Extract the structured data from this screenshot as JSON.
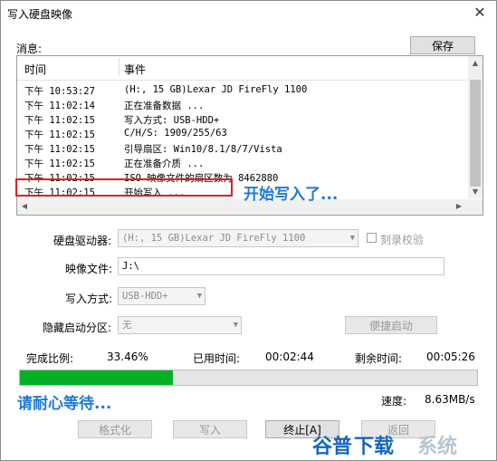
{
  "window": {
    "title": "写入硬盘映像",
    "close_glyph": "✕"
  },
  "messages": {
    "label": "消息:",
    "save_button": "保存",
    "columns": {
      "time": "时间",
      "event": "事件"
    },
    "rows": [
      {
        "time": "下午 10:53:27",
        "event": "(H:, 15 GB)Lexar   JD FireFly      1100"
      },
      {
        "time": "下午 11:02:14",
        "event": "正在准备数据 ..."
      },
      {
        "time": "下午 11:02:15",
        "event": "写入方式: USB-HDD+"
      },
      {
        "time": "下午 11:02:15",
        "event": "C/H/S: 1909/255/63"
      },
      {
        "time": "下午 11:02:15",
        "event": "引导扇区: Win10/8.1/8/7/Vista"
      },
      {
        "time": "下午 11:02:15",
        "event": "正在准备介质 ..."
      },
      {
        "time": "下午 11:02:15",
        "event": "ISO 映像文件的扇区数为 8462880"
      },
      {
        "time": "下午 11:02:15",
        "event": "开始写入 ..."
      }
    ]
  },
  "annotations": {
    "writing_started": "开始写入了...",
    "please_wait": "请耐心等待..."
  },
  "form": {
    "drive_label": "硬盘驱动器:",
    "drive_value": "(H:, 15 GB)Lexar   JD FireFly      1100",
    "verify_label": "刻录校验",
    "image_label": "映像文件:",
    "image_value": "J:\\",
    "method_label": "写入方式:",
    "method_value": "USB-HDD+",
    "hidden_label": "隐藏启动分区:",
    "hidden_value": "无",
    "quick_boot_button": "便捷启动"
  },
  "progress": {
    "ratio_label": "完成比例:",
    "ratio_value": "33.46%",
    "ratio_fraction": 0.3346,
    "elapsed_label": "已用时间:",
    "elapsed_value": "00:02:44",
    "remaining_label": "剩余时间:",
    "remaining_value": "00:05:26",
    "speed_label": "速度:",
    "speed_value": "8.63MB/s",
    "fill_color": "#06b025"
  },
  "buttons": {
    "format": "格式化",
    "write": "写入",
    "terminate": "终止[A]",
    "back": "返回"
  },
  "watermark": {
    "text_a": "谷普",
    "text_b": "下载",
    "text_c": "系统"
  }
}
